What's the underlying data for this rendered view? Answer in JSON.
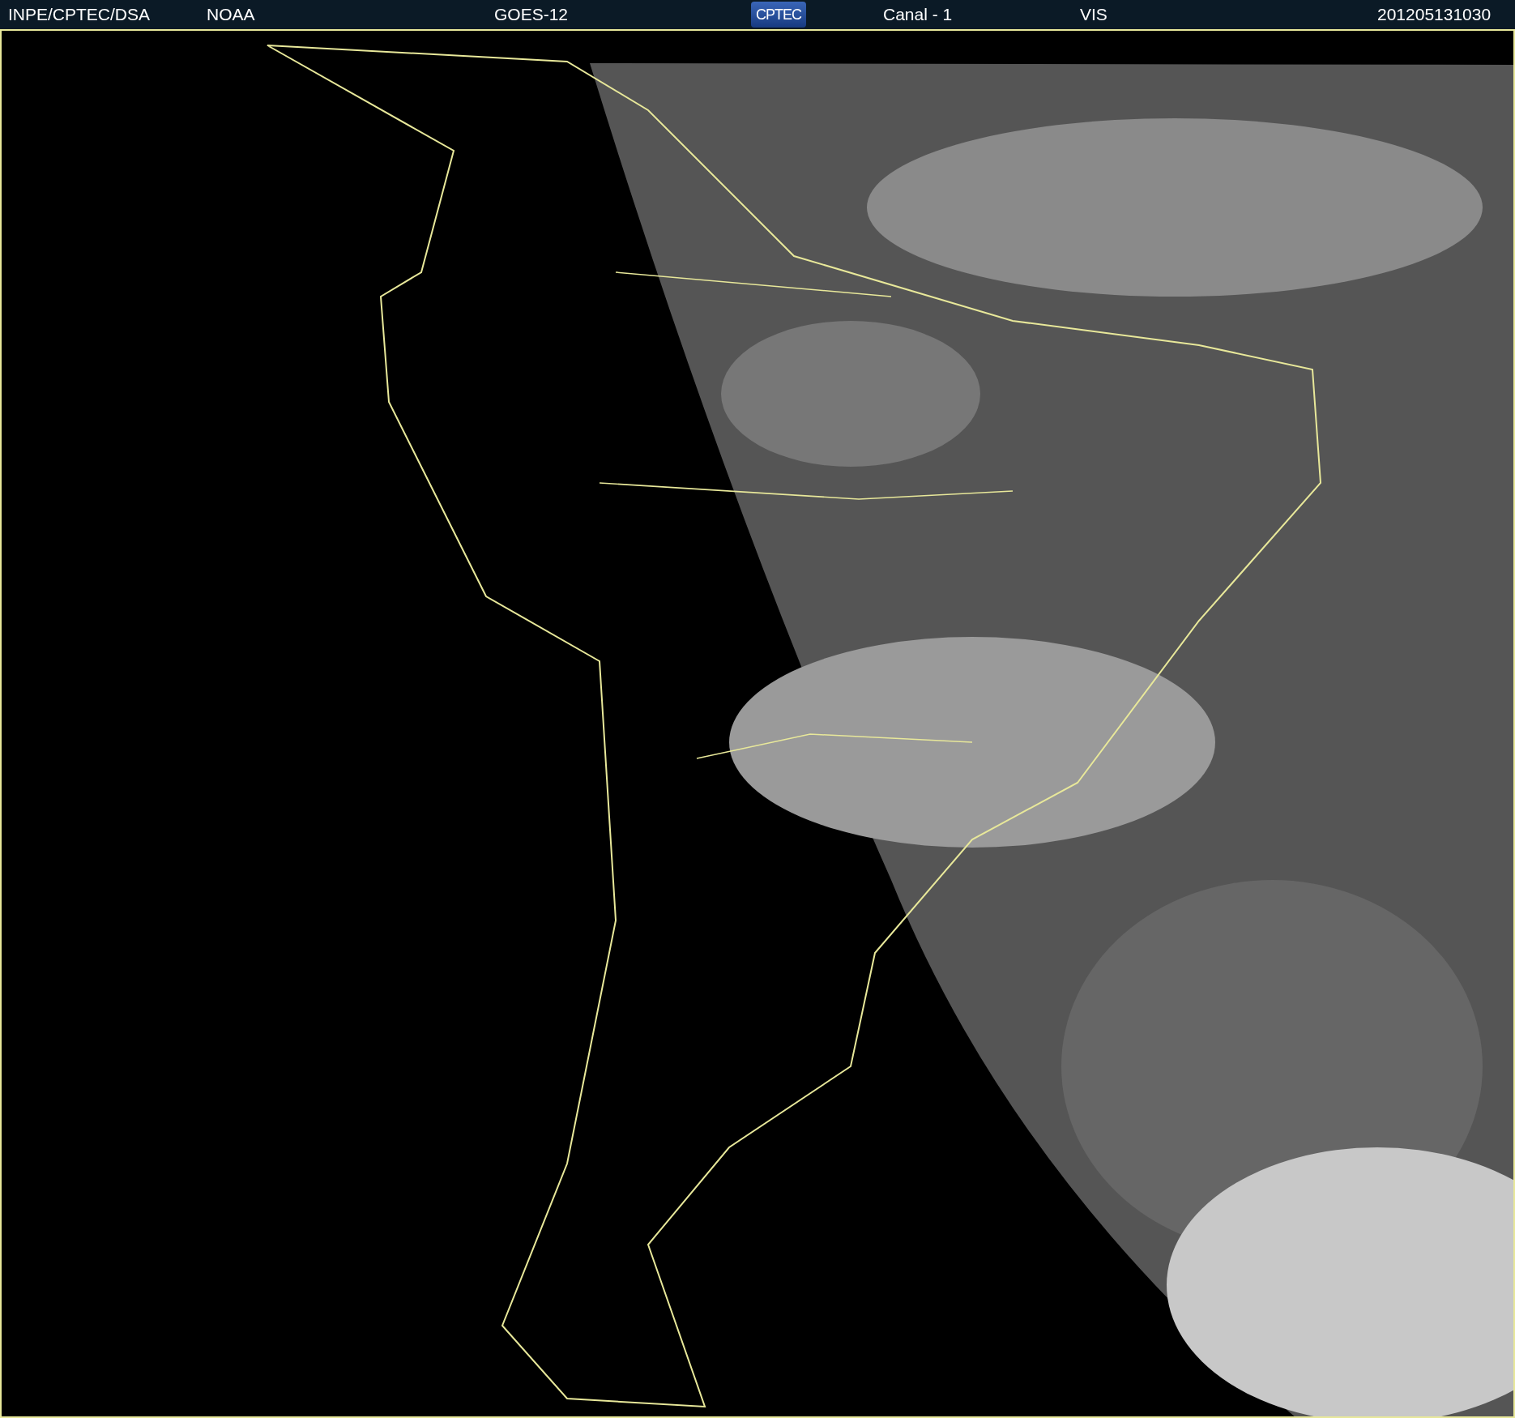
{
  "header": {
    "source": "INPE/CPTEC/DSA",
    "agency": "NOAA",
    "satellite": "GOES-12",
    "logo": "CPTEC",
    "channel": "Canal - 1",
    "band": "VIS",
    "timestamp": "201205131030"
  }
}
